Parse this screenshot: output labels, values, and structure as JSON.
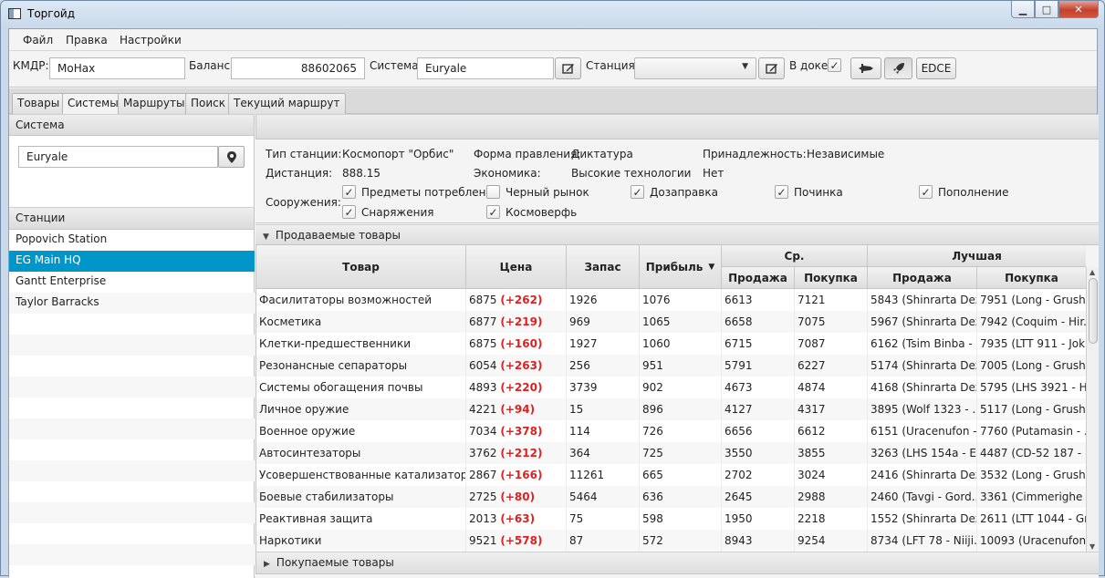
{
  "window": {
    "title": "Торгойд"
  },
  "menu": [
    "Файл",
    "Правка",
    "Настройки"
  ],
  "toolbar": {
    "cmdr_label": "КМДР:",
    "cmdr_value": "MoHax",
    "balance_label": "Баланс:",
    "balance_value": "88602065",
    "system_label": "Система:",
    "system_value": "Euryale",
    "station_label": "Станция:",
    "station_value": "",
    "docked_label": "В доке:",
    "docked_checked": true,
    "edce_label": "EDCE"
  },
  "tabs": [
    "Товары",
    "Системы",
    "Маршруты",
    "Поиск",
    "Текущий маршрут"
  ],
  "active_tab": 1,
  "left": {
    "system_header": "Система",
    "system_search_value": "Euryale",
    "stations_header": "Станции",
    "stations": [
      "Popovich Station",
      "EG Main HQ",
      "Gantt Enterprise",
      "Taylor Barracks"
    ],
    "selected_station": 1
  },
  "station_info": {
    "type_label": "Тип станции:",
    "type_value": "Космопорт \"Орбис\"",
    "distance_label": "Дистанция:",
    "distance_value": "888.15",
    "government_label": "Форма правления:",
    "government_value": "Диктатура",
    "economy_label": "Экономика:",
    "economy_value": "Высокие технологии",
    "allegiance_label": "Принадлежность:",
    "allegiance_value": "Независимые",
    "economy2_value": "Нет",
    "facilities_label": "Сооружения:",
    "facilities": [
      {
        "label": "Предметы потребления",
        "checked": true
      },
      {
        "label": "Черный рынок",
        "checked": false
      },
      {
        "label": "Дозаправка",
        "checked": true
      },
      {
        "label": "Починка",
        "checked": true
      },
      {
        "label": "Пополнение",
        "checked": true
      },
      {
        "label": "Снаряжения",
        "checked": true
      },
      {
        "label": "Космоверфь",
        "checked": true
      }
    ]
  },
  "sold_header": "Продаваемые товары",
  "bought_header": "Покупаемые товары",
  "table": {
    "headers": {
      "item": "Товар",
      "price": "Цена",
      "stock": "Запас",
      "profit": "Прибыль",
      "avg_group": "Ср.",
      "best_group": "Лучшая",
      "avg_sell": "Продажа",
      "avg_buy": "Покупка",
      "best_sell": "Продажа",
      "best_buy": "Покупка"
    },
    "rows": [
      {
        "item": "Фасилитаторы возможностей",
        "price": "6875",
        "delta": "(+262)",
        "stock": "1926",
        "profit": "1076",
        "avg_sell": "6613",
        "avg_buy": "7121",
        "best_sell": "5843 (Shinrarta Dez...",
        "best_buy": "7951 (Long - Grush..."
      },
      {
        "item": "Косметика",
        "price": "6877",
        "delta": "(+219)",
        "stock": "969",
        "profit": "1065",
        "avg_sell": "6658",
        "avg_buy": "7075",
        "best_sell": "5967 (Shinrarta Dez...",
        "best_buy": "7942 (Coquim - Hir..."
      },
      {
        "item": "Клетки-предшественники",
        "price": "6875",
        "delta": "(+160)",
        "stock": "1927",
        "profit": "1060",
        "avg_sell": "6715",
        "avg_buy": "7087",
        "best_sell": "6162 (Tsim Binba - ...",
        "best_buy": "7935 (LTT 911 - Jok..."
      },
      {
        "item": "Резонансные сепараторы",
        "price": "6054",
        "delta": "(+263)",
        "stock": "256",
        "profit": "951",
        "avg_sell": "5791",
        "avg_buy": "6227",
        "best_sell": "5174 (Shinrarta Dez...",
        "best_buy": "7005 (Long - Grush..."
      },
      {
        "item": "Системы обогащения почвы",
        "price": "4893",
        "delta": "(+220)",
        "stock": "3739",
        "profit": "902",
        "avg_sell": "4673",
        "avg_buy": "4874",
        "best_sell": "4168 (Shinrarta Dez...",
        "best_buy": "5795 (LHS 3921 - H..."
      },
      {
        "item": "Личное оружие",
        "price": "4221",
        "delta": "(+94)",
        "stock": "15",
        "profit": "896",
        "avg_sell": "4127",
        "avg_buy": "4317",
        "best_sell": "3895 (Wolf 1323 - ...",
        "best_buy": "5117 (Long - Grush..."
      },
      {
        "item": "Военное оружие",
        "price": "7034",
        "delta": "(+378)",
        "stock": "114",
        "profit": "726",
        "avg_sell": "6656",
        "avg_buy": "6612",
        "best_sell": "6151 (Uracenufon - ...",
        "best_buy": "7760 (Putamasin - ..."
      },
      {
        "item": "Автосинтезаторы",
        "price": "3762",
        "delta": "(+212)",
        "stock": "364",
        "profit": "725",
        "avg_sell": "3550",
        "avg_buy": "3855",
        "best_sell": "3263 (LHS 154a - E...",
        "best_buy": "4487 (CD-52 187 - ..."
      },
      {
        "item": "Усовершенствованные катализаторы",
        "price": "2867",
        "delta": "(+166)",
        "stock": "11261",
        "profit": "665",
        "avg_sell": "2702",
        "avg_buy": "3024",
        "best_sell": "2416 (Shinrarta Dez...",
        "best_buy": "3532 (Long - Grush..."
      },
      {
        "item": "Боевые стабилизаторы",
        "price": "2725",
        "delta": "(+80)",
        "stock": "5464",
        "profit": "636",
        "avg_sell": "2645",
        "avg_buy": "2988",
        "best_sell": "2460 (Tavgi - Gord...",
        "best_buy": "3361 (Cimmerighe ..."
      },
      {
        "item": "Реактивная защита",
        "price": "2013",
        "delta": "(+63)",
        "stock": "75",
        "profit": "598",
        "avg_sell": "1950",
        "avg_buy": "2218",
        "best_sell": "1552 (Shinrarta Dez...",
        "best_buy": "2611 (LTT 1044 - Gr..."
      },
      {
        "item": "Наркотики",
        "price": "9521",
        "delta": "(+578)",
        "stock": "87",
        "profit": "572",
        "avg_sell": "8943",
        "avg_buy": "9254",
        "best_sell": "8734 (LFT 78 - Niiji...",
        "best_buy": "10093 (Uracenufon ..."
      }
    ]
  }
}
